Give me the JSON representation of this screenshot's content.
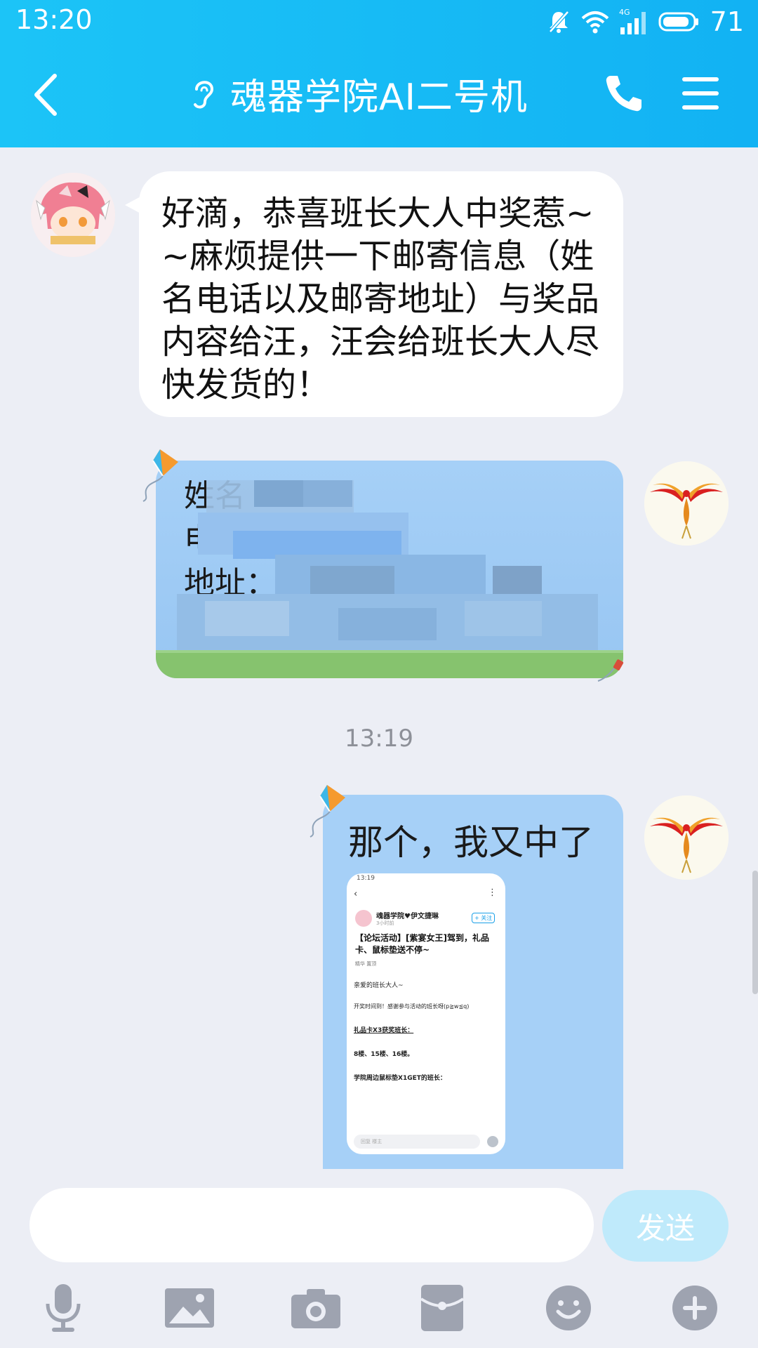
{
  "status_bar": {
    "time": "13:20",
    "network": "4G",
    "battery": "71"
  },
  "header": {
    "title": "魂器学院AI二号机"
  },
  "messages": [
    {
      "side": "left",
      "text": "好滴，恭喜班长大人中奖惹~~麻烦提供一下邮寄信息（姓名电话以及邮寄地址）与奖品内容给汪，汪会给班长大人尽快发货的！"
    },
    {
      "side": "right",
      "lines": [
        "姓名",
        "电话",
        "地址：广"
      ]
    },
    {
      "side": "right",
      "text": "那个，我又中了"
    }
  ],
  "timestamp": "13:19",
  "screenshot_post": {
    "status_time": "13:19",
    "author": "魂器学院♥伊文捷琳",
    "time_ago": "3小时前",
    "follow": "+ 关注",
    "title": "【论坛活动】[紫宴女王]驾到，礼品卡、鼠标垫送不停~",
    "tags": "精华 置顶",
    "lines": [
      "亲爱的班长大人~",
      "开奖时间到！感谢参与活动的班长呀(p≧w≦q)",
      "礼品卡X3获奖班长：",
      "8楼、15楼、16楼。",
      "学院周边鼠标垫X1GET的班长："
    ],
    "input_placeholder": "回复 楼主"
  },
  "input": {
    "placeholder": "",
    "send_label": "发送"
  },
  "colors": {
    "header": "#12b2f3",
    "bubble_right": "#a6d0f7",
    "send_btn": "#bfeafb",
    "icon_gray": "#9ea3b0"
  },
  "toolbar_icons": [
    "microphone-icon",
    "image-icon",
    "camera-icon",
    "red-packet-icon",
    "emoji-icon",
    "plus-icon"
  ]
}
